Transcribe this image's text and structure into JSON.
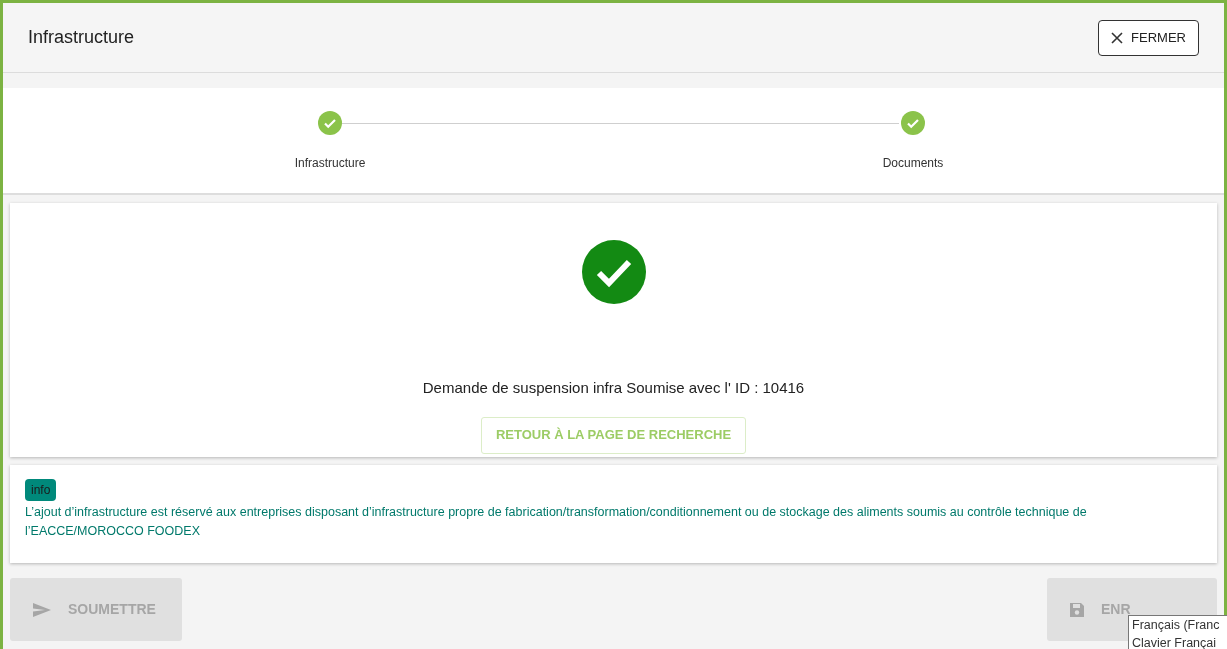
{
  "header": {
    "title": "Infrastructure",
    "close_button": "FERMER"
  },
  "steps": [
    {
      "label": "Infrastructure",
      "completed": true
    },
    {
      "label": "Documents",
      "completed": true
    }
  ],
  "result": {
    "success": true,
    "message": "Demande de suspension infra Soumise avec l' ID : 10416",
    "button": "RETOUR À LA PAGE DE RECHERCHE"
  },
  "info": {
    "badge": "info",
    "text": "L’ajout d’infrastructure est réservé aux entreprises disposant d’infrastructure propre de fabrication/transformation/conditionnement ou de stockage des aliments soumis au contrôle technique de l’EACCE/MOROCCO FOODEX"
  },
  "footer": {
    "buttons": [
      {
        "label": "SOUMETTRE",
        "kind": "submit",
        "disabled": true
      },
      {
        "label": "ENR",
        "kind": "save",
        "disabled": true
      }
    ]
  },
  "tooltip": {
    "lines": [
      "Français (Franc",
      "Clavier Françai"
    ]
  }
}
